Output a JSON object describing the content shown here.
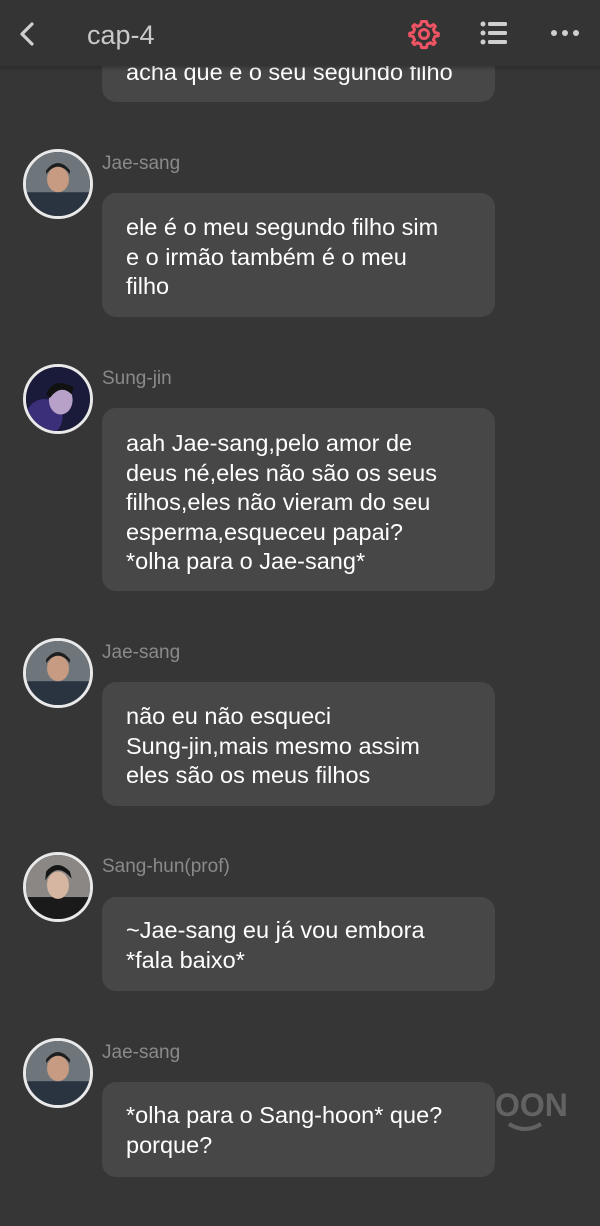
{
  "header": {
    "title": "cap-4",
    "icons": {
      "back": "chevron-left-icon",
      "settings": "gear-icon",
      "list": "list-icon",
      "more": "more-horizontal-icon"
    },
    "accent_color": "#f05364"
  },
  "messages": [
    {
      "sender": "",
      "text": "acha que é o seu segundo filho"
    },
    {
      "sender": "Jae-sang",
      "text": "ele é o meu segundo filho sim\ne o irmão também é o meu\nfilho"
    },
    {
      "sender": "Sung-jin",
      "text": "aah Jae-sang,pelo amor de\ndeus né,eles não são os seus\nfilhos,eles não vieram do seu\nesperma,esqueceu papai?\n*olha para o Jae-sang*"
    },
    {
      "sender": "Jae-sang",
      "text": "não eu não esqueci\nSung-jin,mais mesmo assim\neles são os meus filhos"
    },
    {
      "sender": "Sang-hun(prof)",
      "text": "~Jae-sang eu já vou embora\n*fala baixo*"
    },
    {
      "sender": "Jae-sang",
      "text": "*olha para o Sang-hoon* que?\nporque?"
    }
  ],
  "watermark": "OON",
  "colors": {
    "background": "#363636",
    "bubble": "#474747",
    "name": "#8a8a8a"
  }
}
